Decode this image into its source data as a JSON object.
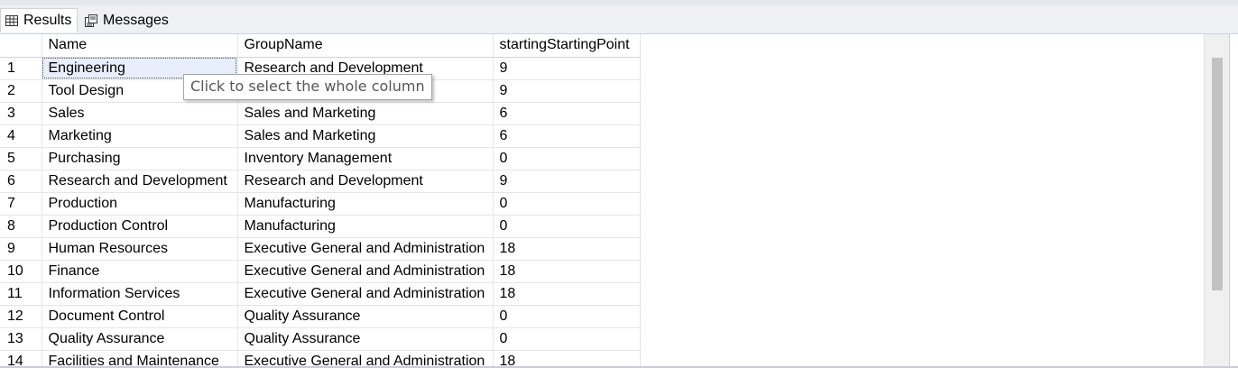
{
  "tabs": [
    {
      "label": "Results",
      "icon": "grid-icon"
    },
    {
      "label": "Messages",
      "icon": "messages-icon"
    }
  ],
  "columns": [
    "Name",
    "GroupName",
    "startingStartingPoint"
  ],
  "rows": [
    [
      "1",
      "Engineering",
      "Research and Development",
      "9"
    ],
    [
      "2",
      "Tool Design",
      "",
      "9"
    ],
    [
      "3",
      "Sales",
      "Sales and Marketing",
      "6"
    ],
    [
      "4",
      "Marketing",
      "Sales and Marketing",
      "6"
    ],
    [
      "5",
      "Purchasing",
      "Inventory Management",
      "0"
    ],
    [
      "6",
      "Research and Development",
      "Research and Development",
      "9"
    ],
    [
      "7",
      "Production",
      "Manufacturing",
      "0"
    ],
    [
      "8",
      "Production Control",
      "Manufacturing",
      "0"
    ],
    [
      "9",
      "Human Resources",
      "Executive General and Administration",
      "18"
    ],
    [
      "10",
      "Finance",
      "Executive General and Administration",
      "18"
    ],
    [
      "11",
      "Information Services",
      "Executive General and Administration",
      "18"
    ],
    [
      "12",
      "Document Control",
      "Quality Assurance",
      "0"
    ],
    [
      "13",
      "Quality Assurance",
      "Quality Assurance",
      "0"
    ],
    [
      "14",
      "Facilities and Maintenance",
      "Executive General and Administration",
      "18"
    ]
  ],
  "tooltip": "Click to select the whole column"
}
